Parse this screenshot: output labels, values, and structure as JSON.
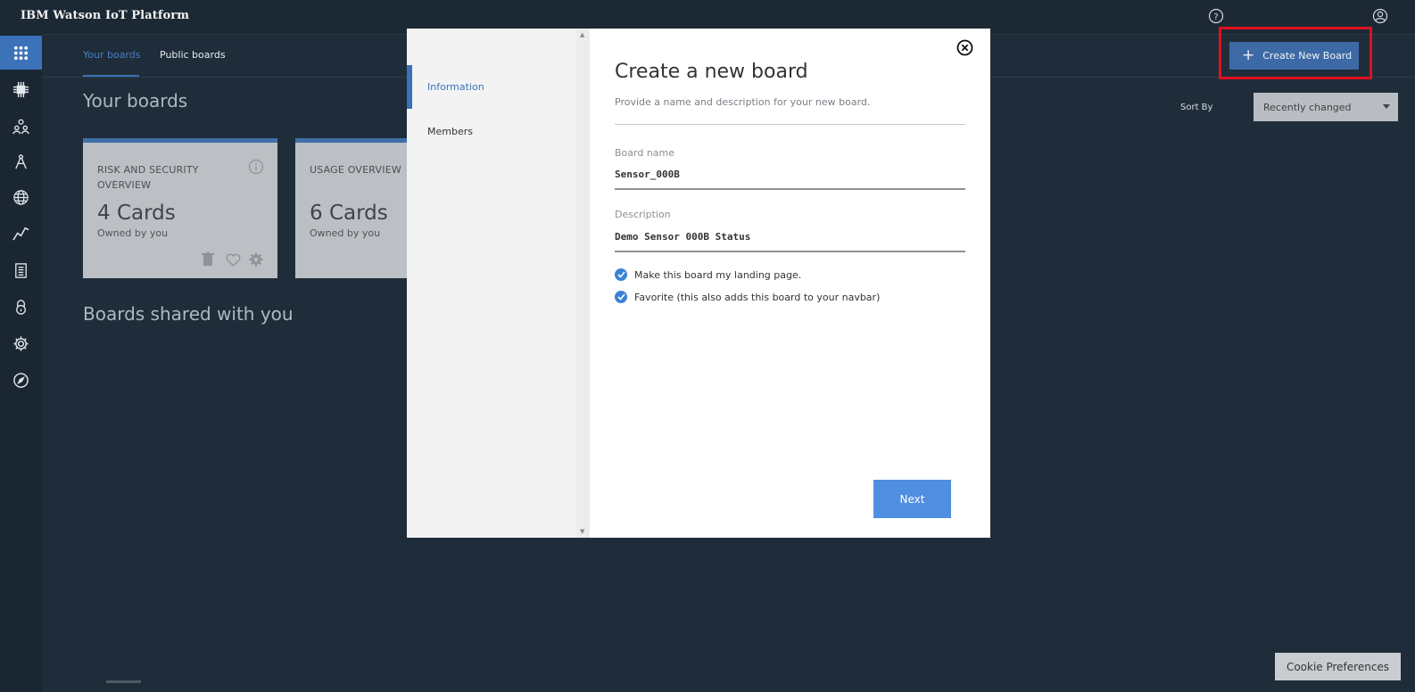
{
  "app": {
    "title": "IBM Watson IoT Platform"
  },
  "top_icons": {
    "help": "help-icon",
    "user": "user-icon"
  },
  "sidebar": {
    "items": [
      {
        "name": "apps-grid-icon",
        "active": true
      },
      {
        "name": "chip-icon"
      },
      {
        "name": "members-icon"
      },
      {
        "name": "compass-drafting-icon"
      },
      {
        "name": "globe-network-icon"
      },
      {
        "name": "analytics-line-icon"
      },
      {
        "name": "document-icon"
      },
      {
        "name": "lock-icon"
      },
      {
        "name": "gear-icon"
      },
      {
        "name": "compass-icon"
      }
    ]
  },
  "tabs": {
    "your_boards": "Your boards",
    "public_boards": "Public boards"
  },
  "section": {
    "your_boards": "Your boards",
    "shared": "Boards shared with you"
  },
  "cards": [
    {
      "title": "RISK AND SECURITY OVERVIEW",
      "count": "4 Cards",
      "owner": "Owned by you"
    },
    {
      "title": "USAGE OVERVIEW",
      "count": "6 Cards",
      "owner": "Owned by you"
    }
  ],
  "sort": {
    "label": "Sort By",
    "value": "Recently changed"
  },
  "create_button": {
    "label": "Create New Board"
  },
  "cookie": {
    "label": "Cookie Preferences"
  },
  "modal": {
    "nav": {
      "information": "Information",
      "members": "Members"
    },
    "title": "Create a new board",
    "subtitle": "Provide a name and description for your new board.",
    "board_name": {
      "label": "Board name",
      "value": "Sensor_000B"
    },
    "description": {
      "label": "Description",
      "value": "Demo Sensor 000B Status"
    },
    "checkboxes": {
      "landing": "Make this board my landing page.",
      "favorite": "Favorite (this also adds this board to your navbar)"
    },
    "next": "Next"
  },
  "colors": {
    "accent": "#3b72b8",
    "highlight": "#e0101e",
    "next_button": "#4f8ee0"
  }
}
